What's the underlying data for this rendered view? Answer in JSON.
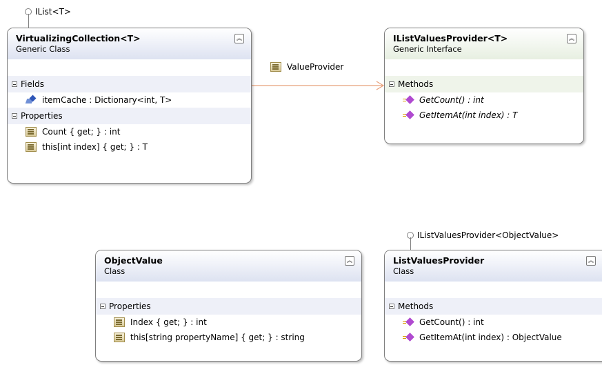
{
  "lollipops": {
    "ilist": "IList<T>",
    "ilistvaluesprovider_objectvalue": "IListValuesProvider<ObjectValue>"
  },
  "association": {
    "label": "ValueProvider"
  },
  "virtualizing_collection": {
    "name": "VirtualizingCollection<T>",
    "kind": "Generic Class",
    "sections": {
      "fields": "Fields",
      "properties": "Properties"
    },
    "fields": [
      "itemCache : Dictionary<int, T>"
    ],
    "properties": [
      "Count { get; } : int",
      "this[int index] { get; } : T"
    ]
  },
  "ilist_values_provider": {
    "name": "IListValuesProvider<T>",
    "kind": "Generic Interface",
    "sections": {
      "methods": "Methods"
    },
    "methods": [
      "GetCount() : int",
      "GetItemAt(int index) : T"
    ]
  },
  "object_value": {
    "name": "ObjectValue",
    "kind": "Class",
    "sections": {
      "properties": "Properties"
    },
    "properties": [
      "Index { get; } : int",
      "this[string propertyName] { get; } : string"
    ]
  },
  "list_values_provider": {
    "name": "ListValuesProvider",
    "kind": "Class",
    "sections": {
      "methods": "Methods"
    },
    "methods": [
      "GetCount() : int",
      "GetItemAt(int index) : ObjectValue"
    ]
  },
  "colors": {
    "class_header": "#dde2f1",
    "interface_header": "#e7efe1",
    "association_line": "#e8a07a",
    "border": "#7f7f7f"
  },
  "icons": {
    "property": "property-icon",
    "field": "field-icon",
    "method": "method-icon",
    "collapse": "collapse-chevron-icon",
    "interface_lollipop": "interface-lollipop-icon"
  }
}
